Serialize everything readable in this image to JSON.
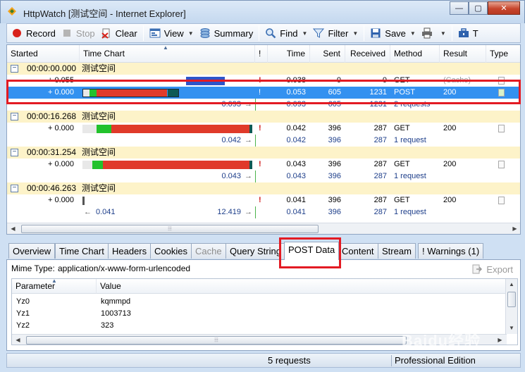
{
  "window": {
    "title": "HttpWatch [测试空间 - Internet Explorer]",
    "minimize_label": "—",
    "maximize_label": "▢",
    "close_label": "✕"
  },
  "toolbar": {
    "record": "Record",
    "stop": "Stop",
    "clear": "Clear",
    "view": "View",
    "summary": "Summary",
    "find": "Find",
    "filter": "Filter",
    "save": "Save",
    "more": "T"
  },
  "columns": {
    "started": "Started",
    "time_chart": "Time Chart",
    "warn": "!",
    "time": "Time",
    "sent": "Sent",
    "received": "Received",
    "method": "Method",
    "result": "Result",
    "type": "Type"
  },
  "groups": [
    {
      "started": "00:00:00.000",
      "title": "测试空间",
      "entries": [
        {
          "offset": "+ 0.055",
          "warn": "!",
          "time": "0.038",
          "sent": "0",
          "received": "0",
          "method": "GET",
          "result": "(Cache)",
          "bars": [
            {
              "s": 0.61,
              "e": 0.84,
              "color": "#2e55c9"
            }
          ]
        },
        {
          "offset": "+ 0.000",
          "warn": "!",
          "time": "0.053",
          "sent": "605",
          "received": "1231",
          "method": "POST",
          "result": "200",
          "selected": true,
          "bars": [
            {
              "s": 0.0,
              "e": 0.04,
              "color": "#e8e8e8"
            },
            {
              "s": 0.04,
              "e": 0.085,
              "color": "#22c22c"
            },
            {
              "s": 0.085,
              "e": 0.5,
              "color": "#e03a2a"
            },
            {
              "s": 0.5,
              "e": 0.57,
              "color": "#0e5a55"
            }
          ]
        }
      ],
      "summary": {
        "left": "",
        "right": "0.093",
        "time": "0.093",
        "sent": "605",
        "received": "1231",
        "method": "2 requests"
      }
    },
    {
      "started": "00:00:16.268",
      "title": "测试空间",
      "entries": [
        {
          "offset": "+ 0.000",
          "warn": "!",
          "time": "0.042",
          "sent": "396",
          "received": "287",
          "method": "GET",
          "result": "200",
          "bars": [
            {
              "s": 0.0,
              "e": 0.085,
              "color": "#e8e8e8"
            },
            {
              "s": 0.085,
              "e": 0.17,
              "color": "#22c22c"
            },
            {
              "s": 0.17,
              "e": 0.985,
              "color": "#e03a2a"
            },
            {
              "s": 0.985,
              "e": 1.0,
              "color": "#0e5a55"
            }
          ]
        }
      ],
      "summary": {
        "left": "",
        "right": "0.042",
        "time": "0.042",
        "sent": "396",
        "received": "287",
        "method": "1 request"
      }
    },
    {
      "started": "00:00:31.254",
      "title": "测试空间",
      "entries": [
        {
          "offset": "+ 0.000",
          "warn": "!",
          "time": "0.043",
          "sent": "396",
          "received": "287",
          "method": "GET",
          "result": "200",
          "bars": [
            {
              "s": 0.0,
              "e": 0.06,
              "color": "#e8e8e8"
            },
            {
              "s": 0.06,
              "e": 0.12,
              "color": "#22c22c"
            },
            {
              "s": 0.12,
              "e": 0.985,
              "color": "#e03a2a"
            },
            {
              "s": 0.985,
              "e": 1.0,
              "color": "#0e5a55"
            }
          ]
        }
      ],
      "summary": {
        "left": "",
        "right": "0.043",
        "time": "0.043",
        "sent": "396",
        "received": "287",
        "method": "1 request"
      }
    },
    {
      "started": "00:00:46.263",
      "title": "测试空间",
      "entries": [
        {
          "offset": "+ 0.000",
          "warn": "!",
          "time": "0.041",
          "sent": "396",
          "received": "287",
          "method": "GET",
          "result": "200",
          "bars": [
            {
              "s": 0.0,
              "e": 0.012,
              "color": "#555"
            }
          ]
        }
      ],
      "summary": {
        "left": "0.041",
        "right": "12.419",
        "time": "0.041",
        "sent": "396",
        "received": "287",
        "method": "1 request"
      }
    }
  ],
  "tabs": [
    {
      "label": "Overview"
    },
    {
      "label": "Time Chart"
    },
    {
      "label": "Headers"
    },
    {
      "label": "Cookies"
    },
    {
      "label": "Cache",
      "disabled": true
    },
    {
      "label": "Query String"
    },
    {
      "label": "POST Data",
      "active": true
    },
    {
      "label": "Content"
    },
    {
      "label": "Stream"
    },
    {
      "label": "! Warnings (1)"
    }
  ],
  "detail": {
    "mime_label": "Mime Type:",
    "mime_value": "application/x-www-form-urlencoded",
    "export": "Export",
    "param_header": "Parameter",
    "value_header": "Value",
    "params": [
      {
        "name": "Yz0",
        "value": "kqmmpd"
      },
      {
        "name": "Yz1",
        "value": "1003713"
      },
      {
        "name": "Yz2",
        "value": "323"
      }
    ]
  },
  "status": {
    "requests": "5 requests",
    "edition": "Professional Edition"
  },
  "colors": {
    "selection": "#3391f0",
    "group": "#fdf3c9",
    "highlight": "#e31b23",
    "summary_text": "#1d3e8a"
  },
  "watermark": "Baidu经验"
}
